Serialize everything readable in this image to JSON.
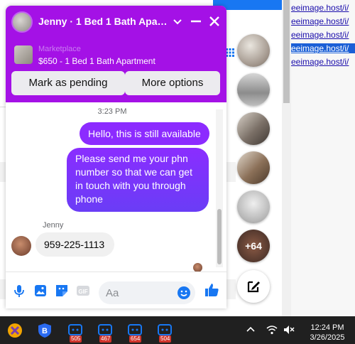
{
  "background": {
    "links": [
      "eeimage.host/i/",
      "eeimage.host/i/",
      "eeimage.host/i/",
      "eeimage.host/i/",
      "eeimage.host/i/"
    ]
  },
  "chat": {
    "title": "Jenny · 1 Bed 1 Bath Apartment",
    "marketplace_label": "Marketplace",
    "listing": "$650 - 1 Bed 1 Bath Apartment",
    "actions": {
      "pending": "Mark as pending",
      "more": "More options"
    },
    "timestamp": "3:23 PM",
    "messages": [
      {
        "from": "me",
        "text": "Hello, this is still available"
      },
      {
        "from": "me",
        "text": "Please send me your phn number so that we can get in touch with you through phone"
      },
      {
        "from": "Jenny",
        "text": "959-225-1113"
      }
    ],
    "sender_name": "Jenny",
    "input_placeholder": "Aa"
  },
  "chat_heads": {
    "more_count": "+64"
  },
  "taskbar": {
    "badges": [
      "505",
      "467",
      "654",
      "504"
    ],
    "time": "12:24 PM",
    "date": "3/26/2025"
  },
  "colors": {
    "header": "#a411e6",
    "bubble": "#8c2bff",
    "messenger_blue": "#1877f2",
    "taskbar": "#202020"
  },
  "icons": [
    "minimize-icon",
    "close-icon",
    "chevron-down-icon",
    "mic-icon",
    "image-icon",
    "sticker-icon",
    "gif-icon",
    "emoji-icon",
    "thumbs-up-icon",
    "compose-icon",
    "wifi-icon",
    "volume-muted-icon",
    "chevron-up-icon"
  ]
}
